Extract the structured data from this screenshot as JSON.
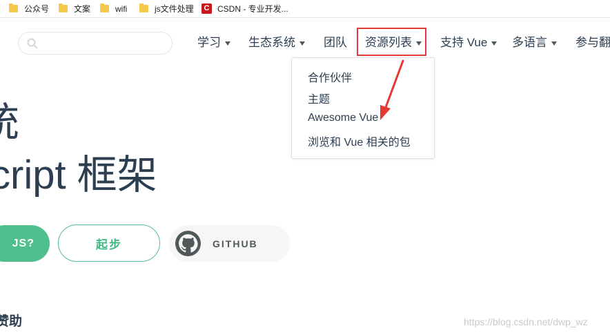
{
  "bookmarks": [
    {
      "label": "公众号",
      "icon": "folder-icon"
    },
    {
      "label": "文案",
      "icon": "folder-icon"
    },
    {
      "label": "wifi",
      "icon": "folder-icon"
    },
    {
      "label": "js文件处理",
      "icon": "folder-icon"
    },
    {
      "label": "CSDN - 专业开发...",
      "icon": "csdn-logo-icon",
      "icon_text": "C"
    }
  ],
  "search": {
    "placeholder": "",
    "value": ""
  },
  "nav": {
    "learn": "学习",
    "ecosystem": "生态系统",
    "team": "团队",
    "resources": "资源列表",
    "support": "支持 Vue",
    "languages": "多语言",
    "translate": "参与翻"
  },
  "dropdown": {
    "items": [
      "合作伙伴",
      "主题",
      "Awesome Vue",
      "浏览和 Vue 相关的包"
    ]
  },
  "hero": {
    "line1": "统",
    "line2": "cript 框架"
  },
  "buttons": {
    "why": "JS?",
    "get_started": "起步",
    "github": "GITHUB"
  },
  "sponsor_heading": "赞助",
  "watermark": "https://blog.csdn.net/dwp_wz",
  "colors": {
    "accent": "#4fc08d",
    "highlight": "#e53935",
    "text": "#2c3e50"
  }
}
